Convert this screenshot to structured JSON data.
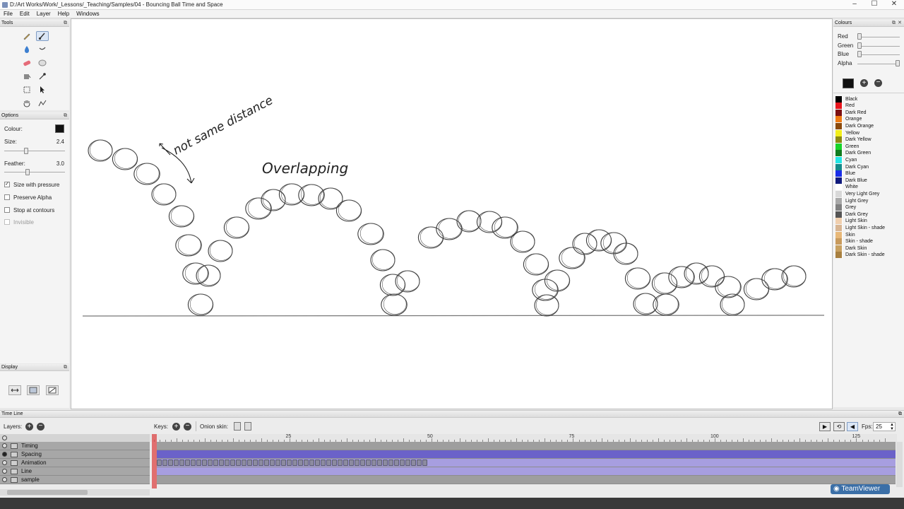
{
  "window": {
    "title": "D:/Art Works/Work/_Lessons/_Teaching/Samples/04 - Bouncing Ball Time and Space",
    "min_label": "–",
    "max_label": "☐",
    "close_label": "✕"
  },
  "menu": [
    "File",
    "Edit",
    "Layer",
    "Help",
    "Windows"
  ],
  "tools_panel": {
    "title": "Tools"
  },
  "options_panel": {
    "title": "Options",
    "colour_label": "Colour:",
    "size_label": "Size:",
    "size_value": "2.4",
    "size_level": 0.35,
    "feather_label": "Feather:",
    "feather_value": "3.0",
    "feather_level": 0.38,
    "checks": [
      {
        "label": "Size with pressure",
        "checked": true,
        "enabled": true
      },
      {
        "label": "Preserve Alpha",
        "checked": false,
        "enabled": true
      },
      {
        "label": "Stop at contours",
        "checked": false,
        "enabled": true
      },
      {
        "label": "Invisible",
        "checked": false,
        "enabled": false
      }
    ]
  },
  "display_panel": {
    "title": "Display"
  },
  "canvas": {
    "annotations": [
      "not same distance",
      "Overlapping"
    ]
  },
  "colours_panel": {
    "title": "Colours",
    "channels": [
      {
        "label": "Red",
        "level": 0.0
      },
      {
        "label": "Green",
        "level": 0.0
      },
      {
        "label": "Blue",
        "level": 0.0
      },
      {
        "label": "Alpha",
        "level": 1.0
      }
    ],
    "current_colour": "#111111",
    "palette": [
      {
        "name": "Black",
        "color": "#000000"
      },
      {
        "name": "Red",
        "color": "#e8141c"
      },
      {
        "name": "Dark Red",
        "color": "#7c0f12"
      },
      {
        "name": "Orange",
        "color": "#f07b12"
      },
      {
        "name": "Dark Orange",
        "color": "#8c4a0c"
      },
      {
        "name": "Yellow",
        "color": "#f2ee1a"
      },
      {
        "name": "Dark Yellow",
        "color": "#8b8a12"
      },
      {
        "name": "Green",
        "color": "#17d42a"
      },
      {
        "name": "Dark Green",
        "color": "#0f7c1e"
      },
      {
        "name": "Cyan",
        "color": "#22e6e6"
      },
      {
        "name": "Dark Cyan",
        "color": "#158a8a"
      },
      {
        "name": "Blue",
        "color": "#1a2ee8"
      },
      {
        "name": "Dark Blue",
        "color": "#101a7c"
      },
      {
        "name": "White",
        "color": "#ffffff"
      },
      {
        "name": "Very Light Grey",
        "color": "#d8d8d8"
      },
      {
        "name": "Light Grey",
        "color": "#a8a8a8"
      },
      {
        "name": "Grey",
        "color": "#808080"
      },
      {
        "name": "Dark Grey",
        "color": "#555555"
      },
      {
        "name": "Light Skin",
        "color": "#f0cfae"
      },
      {
        "name": "Light Skin - shade",
        "color": "#d8b592"
      },
      {
        "name": "Skin",
        "color": "#e8b878"
      },
      {
        "name": "Skin - shade",
        "color": "#c89a5c"
      },
      {
        "name": "Dark Skin",
        "color": "#c8a060"
      },
      {
        "name": "Dark Skin - shade",
        "color": "#a88040"
      }
    ]
  },
  "timeline": {
    "title": "Time Line",
    "layers_label": "Layers:",
    "keys_label": "Keys:",
    "onion_label": "Onion skin:",
    "fps_label": "Fps:",
    "fps_value": "25",
    "ruler_ticks": [
      "25",
      "50",
      "75",
      "100",
      "125"
    ],
    "layers": [
      {
        "name": "Timing",
        "visible": false
      },
      {
        "name": "Spacing",
        "visible": true
      },
      {
        "name": "Animation",
        "visible": false
      },
      {
        "name": "Line",
        "visible": false
      },
      {
        "name": "sample",
        "visible": false
      }
    ],
    "current_frame": 1,
    "animation_keyframes": 48
  },
  "overlay": {
    "teamviewer_label": "TeamViewer"
  }
}
